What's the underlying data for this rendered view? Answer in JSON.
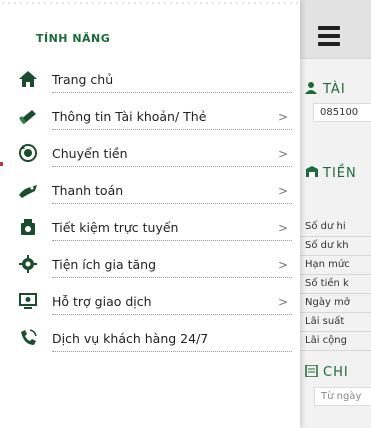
{
  "sidebar": {
    "title": "TÍNH NĂNG",
    "items": [
      {
        "label": "Trang chủ",
        "icon": "home-icon",
        "chevron": ""
      },
      {
        "label": "Thông tin Tài khoản/ Thẻ",
        "icon": "card-icon",
        "chevron": ">"
      },
      {
        "label": "Chuyển tiền",
        "icon": "transfer-icon",
        "chevron": ">"
      },
      {
        "label": "Thanh toán",
        "icon": "payment-icon",
        "chevron": ">"
      },
      {
        "label": "Tiết kiệm trực tuyến",
        "icon": "savings-icon",
        "chevron": ">"
      },
      {
        "label": "Tiện ích gia tăng",
        "icon": "gear-icon",
        "chevron": ">"
      },
      {
        "label": "Hỗ trợ giao dịch",
        "icon": "monitor-support-icon",
        "chevron": ">"
      },
      {
        "label": "Dịch vụ khách hàng 24/7",
        "icon": "phone-support-icon",
        "chevron": ""
      }
    ]
  },
  "page": {
    "account_section": "TÀI",
    "account_number": "085100",
    "money_section": "TIỀN",
    "rows": [
      "Số dư hi",
      "Số dư kh",
      "Hạn mức",
      "Số tiền k",
      "Ngày mở",
      "Lãi suất",
      "Lãi cộng"
    ],
    "detail_section": "CHI",
    "date_placeholder": "Từ ngày"
  },
  "colors": {
    "brand_green": "#1a6b38",
    "page_bg": "#f2f2f2",
    "header_bg": "#e2e2e2"
  }
}
